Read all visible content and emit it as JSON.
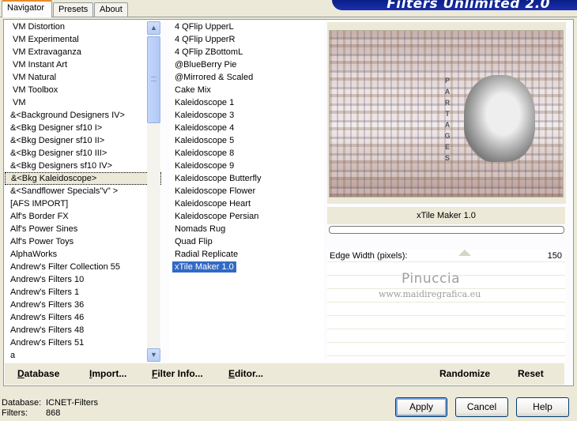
{
  "tabs": [
    "Navigator",
    "Presets",
    "About"
  ],
  "banner_title": "Filters Unlimited 2.0",
  "categories": [
    "VM Distortion",
    "VM Experimental",
    "VM Extravaganza",
    "VM Instant Art",
    "VM Natural",
    "VM Toolbox",
    "VM",
    "&<Background Designers IV>",
    "&<Bkg Designer sf10 I>",
    "&<Bkg Designer sf10 II>",
    "&<Bkg Designer sf10 III>",
    "&<Bkg Designers sf10 IV>",
    "&<Bkg Kaleidoscope>",
    "&<Sandflower Specials\"v\" >",
    "[AFS IMPORT]",
    "Alf's Border FX",
    "Alf's Power Sines",
    "Alf's Power Toys",
    "AlphaWorks",
    "Andrew's Filter Collection 55",
    "Andrew's Filters 10",
    "Andrew's Filters 1",
    "Andrew's Filters 36",
    "Andrew's Filters 46",
    "Andrew's Filters 48",
    "Andrew's Filters 51",
    "a"
  ],
  "selected_category": "&<Bkg Kaleidoscope>",
  "filters": [
    "4 QFlip UpperL",
    "4 QFlip UpperR",
    "4 QFlip ZBottomL",
    "@BlueBerry Pie",
    "@Mirrored & Scaled",
    "Cake Mix",
    "Kaleidoscope 1",
    "Kaleidoscope 3",
    "Kaleidoscope 4",
    "Kaleidoscope 5",
    "Kaleidoscope 8",
    "Kaleidoscope 9",
    "Kaleidoscope Butterfly",
    "Kaleidoscope Flower",
    "Kaleidoscope Heart",
    "Kaleidoscope Persian",
    "Nomads Rug",
    "Quad Flip",
    "Radial Replicate",
    "xTile Maker 1.0"
  ],
  "selected_filter": "xTile Maker 1.0",
  "preview": {
    "vertical_text": "PARTAGES"
  },
  "filter_title": "xTile Maker 1.0",
  "params": [
    {
      "label": "Edge Width (pixels):",
      "value": "150"
    }
  ],
  "watermark": {
    "line1": "Pinuccia",
    "line2": "www.maidiregrafica.eu"
  },
  "commands": {
    "database": "Database",
    "import": "Import...",
    "filter_info": "Filter Info...",
    "editor": "Editor...",
    "randomize": "Randomize",
    "reset": "Reset"
  },
  "status": {
    "database_label": "Database:",
    "database_value": "ICNET-Filters",
    "filters_label": "Filters:",
    "filters_value": "868"
  },
  "buttons": {
    "apply": "Apply",
    "cancel": "Cancel",
    "help": "Help"
  },
  "colors": {
    "selection": "#316ac5",
    "banner": "#0a1f86",
    "face": "#ece9d8"
  }
}
